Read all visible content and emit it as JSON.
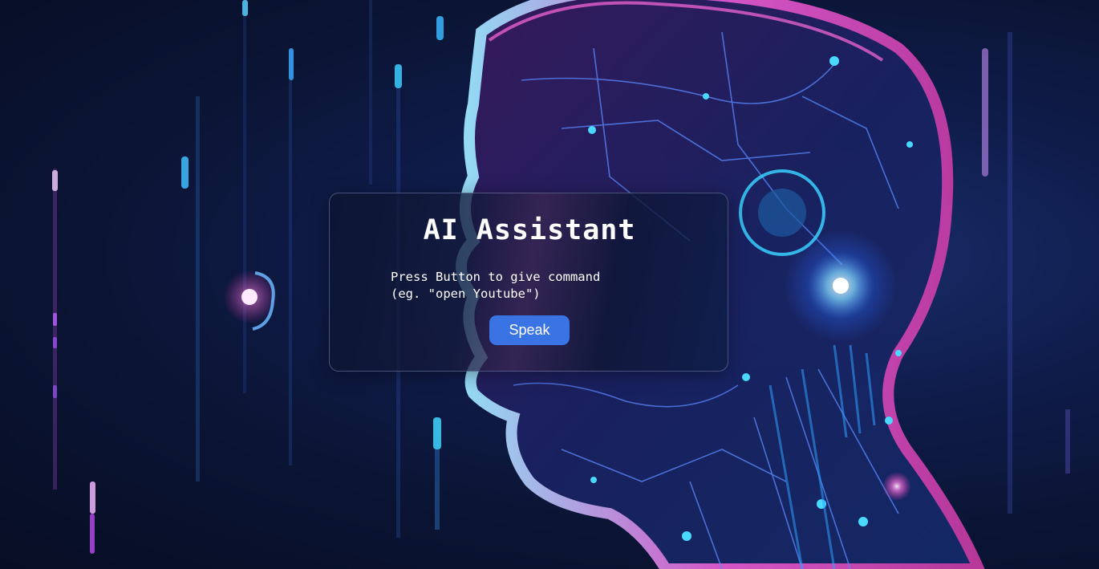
{
  "assistant": {
    "title": "AI Assistant",
    "instruction_line1": "Press Button to give command",
    "instruction_line2": "(eg. \"open Youtube\")",
    "speak_button_label": "Speak"
  },
  "colors": {
    "background": "#0a1433",
    "button": "#3a74e4",
    "accent_pink": "#c03aa0",
    "accent_cyan": "#3fc7ff"
  }
}
